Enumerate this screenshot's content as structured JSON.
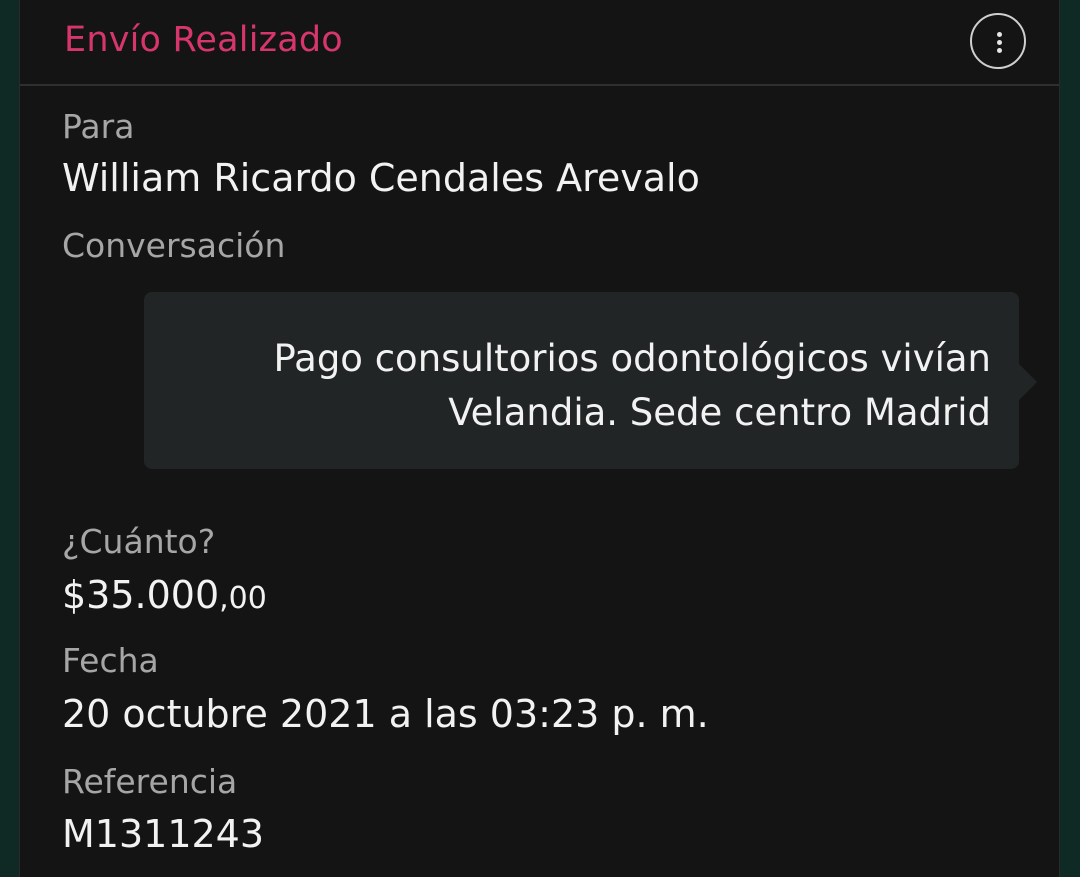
{
  "header": {
    "title": "Envío Realizado",
    "menu_icon": "more-vertical-icon"
  },
  "recipient": {
    "label": "Para",
    "name": "William Ricardo Cendales Arevalo"
  },
  "conversation": {
    "label": "Conversación",
    "message_line1": "Pago consultorios odontológicos vivían",
    "message_line2": "Velandia. Sede centro Madrid"
  },
  "amount": {
    "label": "¿Cuánto?",
    "main": "$35.000",
    "cents": ",00"
  },
  "date": {
    "label": "Fecha",
    "value": "20 octubre 2021 a las 03:23 p. m."
  },
  "reference": {
    "label": "Referencia",
    "value": "M1311243"
  },
  "colors": {
    "title": "#d6366c",
    "background": "#141414",
    "bubble": "#222526",
    "label": "#a6a6a6",
    "value": "#f2f2f2"
  }
}
